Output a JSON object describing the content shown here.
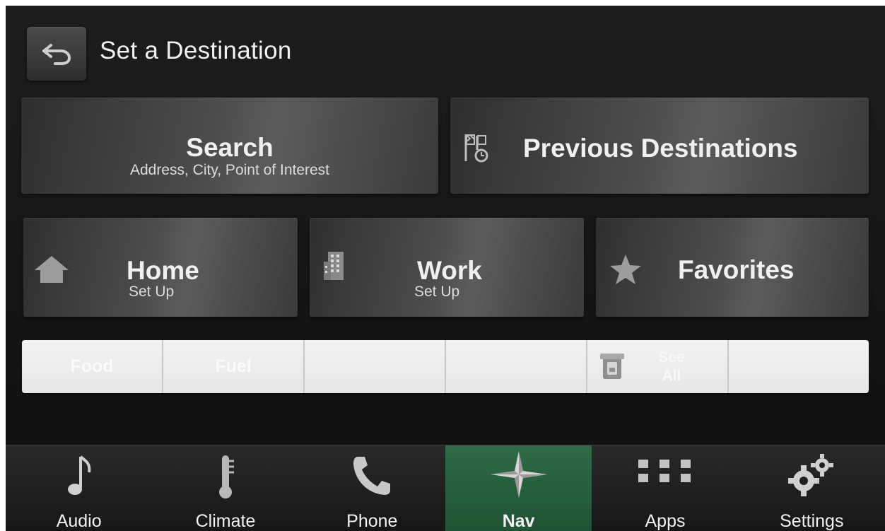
{
  "header": {
    "title": "Set a Destination"
  },
  "tiles": {
    "search": {
      "label": "Search",
      "sublabel": "Address, City, Point of Interest"
    },
    "previous_destinations": {
      "label": "Previous Destinations"
    },
    "home": {
      "label": "Home",
      "sublabel": "Set Up"
    },
    "work": {
      "label": "Work",
      "sublabel": "Set Up"
    },
    "favorites": {
      "label": "Favorites"
    }
  },
  "categories": {
    "items": [
      "Food",
      "Fuel",
      "",
      "",
      "See All",
      ""
    ]
  },
  "navbar": {
    "items": [
      {
        "label": "Audio",
        "icon": "music-note-icon"
      },
      {
        "label": "Climate",
        "icon": "thermometer-icon"
      },
      {
        "label": "Phone",
        "icon": "phone-icon"
      },
      {
        "label": "Nav",
        "icon": "compass-star-icon",
        "active": true
      },
      {
        "label": "Apps",
        "icon": "apps-grid-icon"
      },
      {
        "label": "Settings",
        "icon": "gears-icon"
      }
    ]
  },
  "colors": {
    "active_tab": "#2f6a45",
    "tile": "#4c4c4c",
    "category_bar": "#ececec"
  }
}
